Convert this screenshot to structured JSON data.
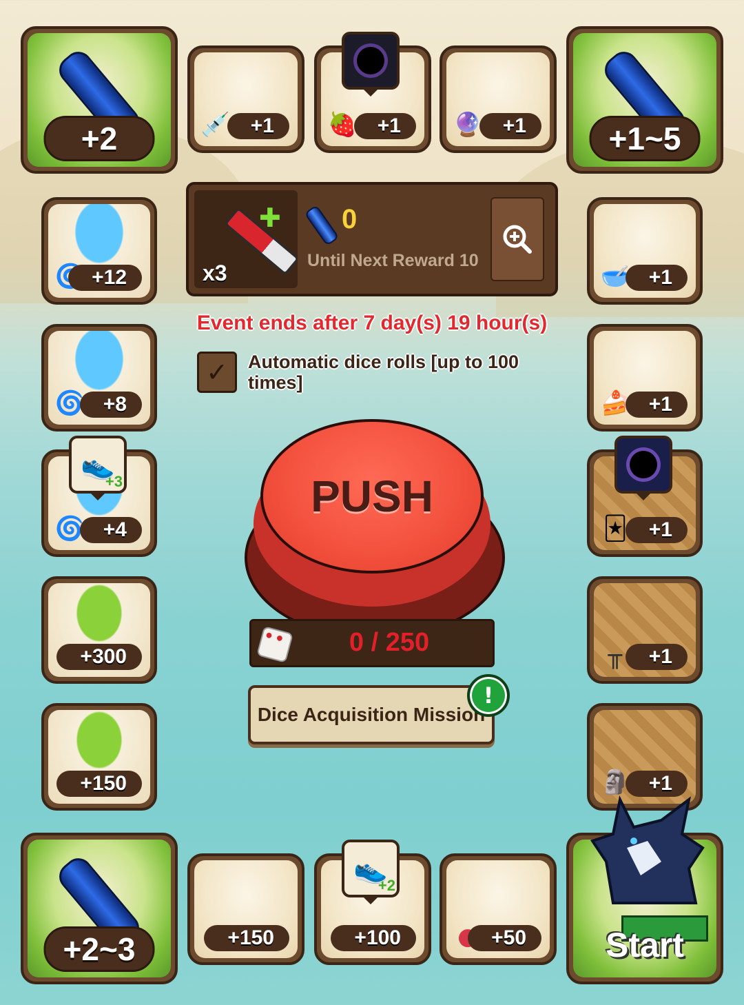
{
  "corners": {
    "top_left": {
      "value": "+2",
      "icon": "blue-bat-icon"
    },
    "top_right": {
      "value": "+1~5",
      "icon": "blue-bat-icon"
    },
    "bottom_left": {
      "value": "+2~3",
      "icon": "blue-bat-icon"
    },
    "bottom_right": {
      "label": "Start",
      "icon": "arrow-left-icon"
    }
  },
  "top_row": [
    {
      "value": "+1",
      "icon": "syringe-icon"
    },
    {
      "value": "+1",
      "icon": "jam-jar-icon",
      "pin": "black-hole-icon"
    },
    {
      "value": "+1",
      "icon": "crystal-icon"
    }
  ],
  "left_column": [
    {
      "value": "+12",
      "icon": "blue-swirl-icon",
      "tile": "blue"
    },
    {
      "value": "+8",
      "icon": "blue-swirl-icon",
      "tile": "blue"
    },
    {
      "value": "+4",
      "icon": "blue-swirl-icon",
      "tile": "blue",
      "pin": "shoe-icon",
      "pin_text": "+3"
    },
    {
      "value": "+300",
      "icon": "green-crystal-icon",
      "tile": "green"
    },
    {
      "value": "+150",
      "icon": "green-crystal-icon",
      "tile": "green"
    }
  ],
  "right_column": [
    {
      "value": "+1",
      "icon": "orb-bowl-icon",
      "tile": "plain"
    },
    {
      "value": "+1",
      "icon": "cake-icon",
      "tile": "plain"
    },
    {
      "value": "+1",
      "icon": "monster-card-icon",
      "tile": "dirt",
      "pin": "black-hole-icon"
    },
    {
      "value": "+1",
      "icon": "hurdle-icon",
      "tile": "dirt"
    },
    {
      "value": "+1",
      "icon": "totem-icon",
      "tile": "dirt"
    }
  ],
  "bottom_row": [
    {
      "value": "+150",
      "icon": "red-gem-icon"
    },
    {
      "value": "+100",
      "icon": "red-gem-icon",
      "pin": "shoe-icon",
      "pin_text": "+2"
    },
    {
      "value": "+50",
      "icon": "red-gem-icon"
    }
  ],
  "panel": {
    "multiplier": "x3",
    "count": "0",
    "subtitle": "Until Next Reward 10"
  },
  "event_text": "Event ends after 7 day(s) 19 hour(s)",
  "auto_roll_label": "Automatic dice rolls [up to 100 times]",
  "auto_roll_checked": true,
  "push_label": "PUSH",
  "progress_text": "0 / 250",
  "progress": 0,
  "mission_label": "Dice Acquisition Mission",
  "alert_mark": "!",
  "pin_texts": {
    "left_pin": "+3",
    "bottom_pin": "+2"
  }
}
